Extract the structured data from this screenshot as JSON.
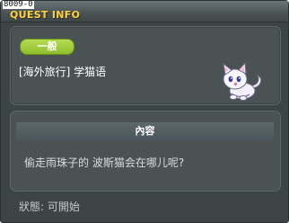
{
  "window": {
    "id_tag": "8009-0",
    "title": "QUEST INFO"
  },
  "quest": {
    "category": "一般",
    "name": "[海外旅行] 学猫语",
    "npc_icon": "white-cat-icon"
  },
  "content": {
    "header": "內容",
    "text": "偷走雨珠子的 波斯猫会在哪儿呢?"
  },
  "status": {
    "text": "狀態: 可開始"
  },
  "colors": {
    "title": "#ffd43c",
    "badge": "#9bc83a",
    "panel": "#4a5254",
    "background": "#3d4446"
  }
}
